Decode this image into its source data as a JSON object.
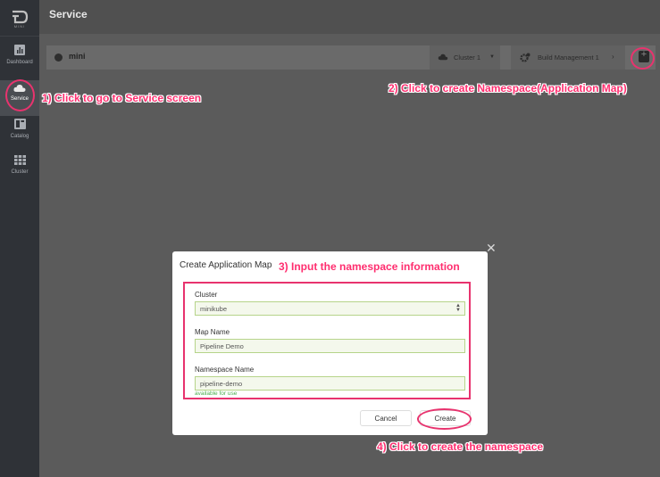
{
  "app": {
    "logo_text": "MINI"
  },
  "sidebar": {
    "items": [
      {
        "label": "Dashboard",
        "icon": "dashboard-icon"
      },
      {
        "label": "Service",
        "icon": "cloud-icon"
      },
      {
        "label": "Catalog",
        "icon": "catalog-icon"
      },
      {
        "label": "Cluster",
        "icon": "grid-icon"
      }
    ]
  },
  "header": {
    "title": "Service"
  },
  "service_bar": {
    "name": "mini",
    "cluster": "Cluster 1",
    "build": "Build Management 1"
  },
  "annotations": {
    "a1": "1) Click to go to Service screen",
    "a2": "2) Click to create Namespace(Application Map)",
    "a3": "3) Input the namespace information",
    "a4": "4) Click to create the namespace"
  },
  "modal": {
    "title": "Create Application Map",
    "cluster_label": "Cluster",
    "cluster_value": "minikube",
    "map_name_label": "Map Name",
    "map_name_value": "Pipeline Demo",
    "namespace_label": "Namespace Name",
    "namespace_value": "pipeline-demo",
    "namespace_hint": "available for use",
    "cancel_label": "Cancel",
    "create_label": "Create"
  },
  "colors": {
    "annotation": "#ff2e6f",
    "sidebar": "#2f3237",
    "overlay": "#5b5b5b",
    "input_bg": "#f4f8ec",
    "input_border": "#b6d48a",
    "hint": "#4caf50"
  }
}
